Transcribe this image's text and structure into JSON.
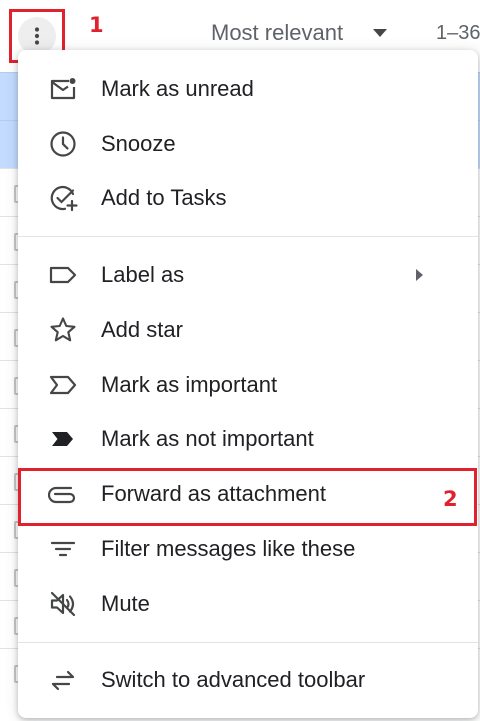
{
  "toolbar": {
    "more_button_step": "1",
    "sort_label": "Most relevant",
    "range_text": "1–36"
  },
  "menu": {
    "items": [
      {
        "label": "Mark as unread",
        "icon": "mark-unread-icon"
      },
      {
        "label": "Snooze",
        "icon": "clock-icon"
      },
      {
        "label": "Add to Tasks",
        "icon": "add-task-icon"
      },
      {
        "label": "Label as",
        "icon": "label-icon"
      },
      {
        "label": "Add star",
        "icon": "star-icon"
      },
      {
        "label": "Mark as important",
        "icon": "important-outline-icon"
      },
      {
        "label": "Mark as not important",
        "icon": "important-filled-icon"
      },
      {
        "label": "Forward as attachment",
        "icon": "paperclip-icon"
      },
      {
        "label": "Filter messages like these",
        "icon": "filter-icon"
      },
      {
        "label": "Mute",
        "icon": "mute-icon"
      },
      {
        "label": "Switch to advanced toolbar",
        "icon": "swap-arrows-icon"
      }
    ],
    "forward_step": "2"
  },
  "colors": {
    "annotation": "#e0212e",
    "icon": "#444746",
    "selected_row": "#c2dbff"
  }
}
